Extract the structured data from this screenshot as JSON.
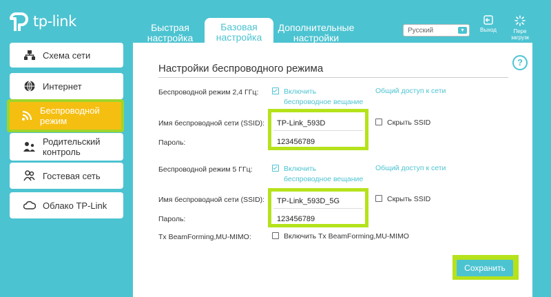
{
  "header": {
    "logo_text": "tp-link",
    "tabs": [
      {
        "label": "Быстрая\nнастройка",
        "active": false
      },
      {
        "label": "Базовая\nнастройка",
        "active": true
      },
      {
        "label": "Дополнительные\nнастройки",
        "active": false
      }
    ],
    "language": "Русский",
    "logout_label": "Выход",
    "reboot_label": "Пере\nзагрузк"
  },
  "sidebar": {
    "items": [
      {
        "label": "Схема сети",
        "icon": "network-map-icon"
      },
      {
        "label": "Интернет",
        "icon": "globe-icon"
      },
      {
        "label": "Беспроводной\nрежим",
        "icon": "wifi-icon",
        "active": true
      },
      {
        "label": "Родительский\nконтроль",
        "icon": "parental-control-icon"
      },
      {
        "label": "Гостевая сеть",
        "icon": "guest-network-icon"
      },
      {
        "label": "Облако TP-Link",
        "icon": "cloud-icon"
      }
    ]
  },
  "main": {
    "title": "Настройки беспроводного режима",
    "band24": {
      "label": "Беспроводной режим 2,4 ГГц:",
      "enable_label": "Включить\nбеспроводное вещание",
      "enabled": true,
      "share_label": "Общий доступ к сети",
      "ssid_label": "Имя беспроводной сети (SSID):",
      "ssid_value": "TP-Link_593D",
      "hide_label": "Скрыть SSID",
      "password_label": "Пароль:",
      "password_value": "123456789"
    },
    "band5": {
      "label": "Беспроводной режим 5 ГГц:",
      "enable_label": "Включить\nбеспроводное вещание",
      "enabled": true,
      "share_label": "Общий доступ к сети",
      "ssid_label": "Имя беспроводной сети (SSID):",
      "ssid_value": "TP-Link_593D_5G",
      "hide_label": "Скрыть SSID",
      "password_label": "Пароль:",
      "password_value": "123456789"
    },
    "beamforming": {
      "label": "Tx BeamForming,MU-MIMO:",
      "enable_label": "Включить Tx BeamForming,MU-MIMO",
      "enabled": false
    },
    "save_label": "Сохранить"
  },
  "colors": {
    "accent": "#4cc3d1",
    "highlight": "#b5e21b",
    "active_item": "#f5bf12"
  }
}
